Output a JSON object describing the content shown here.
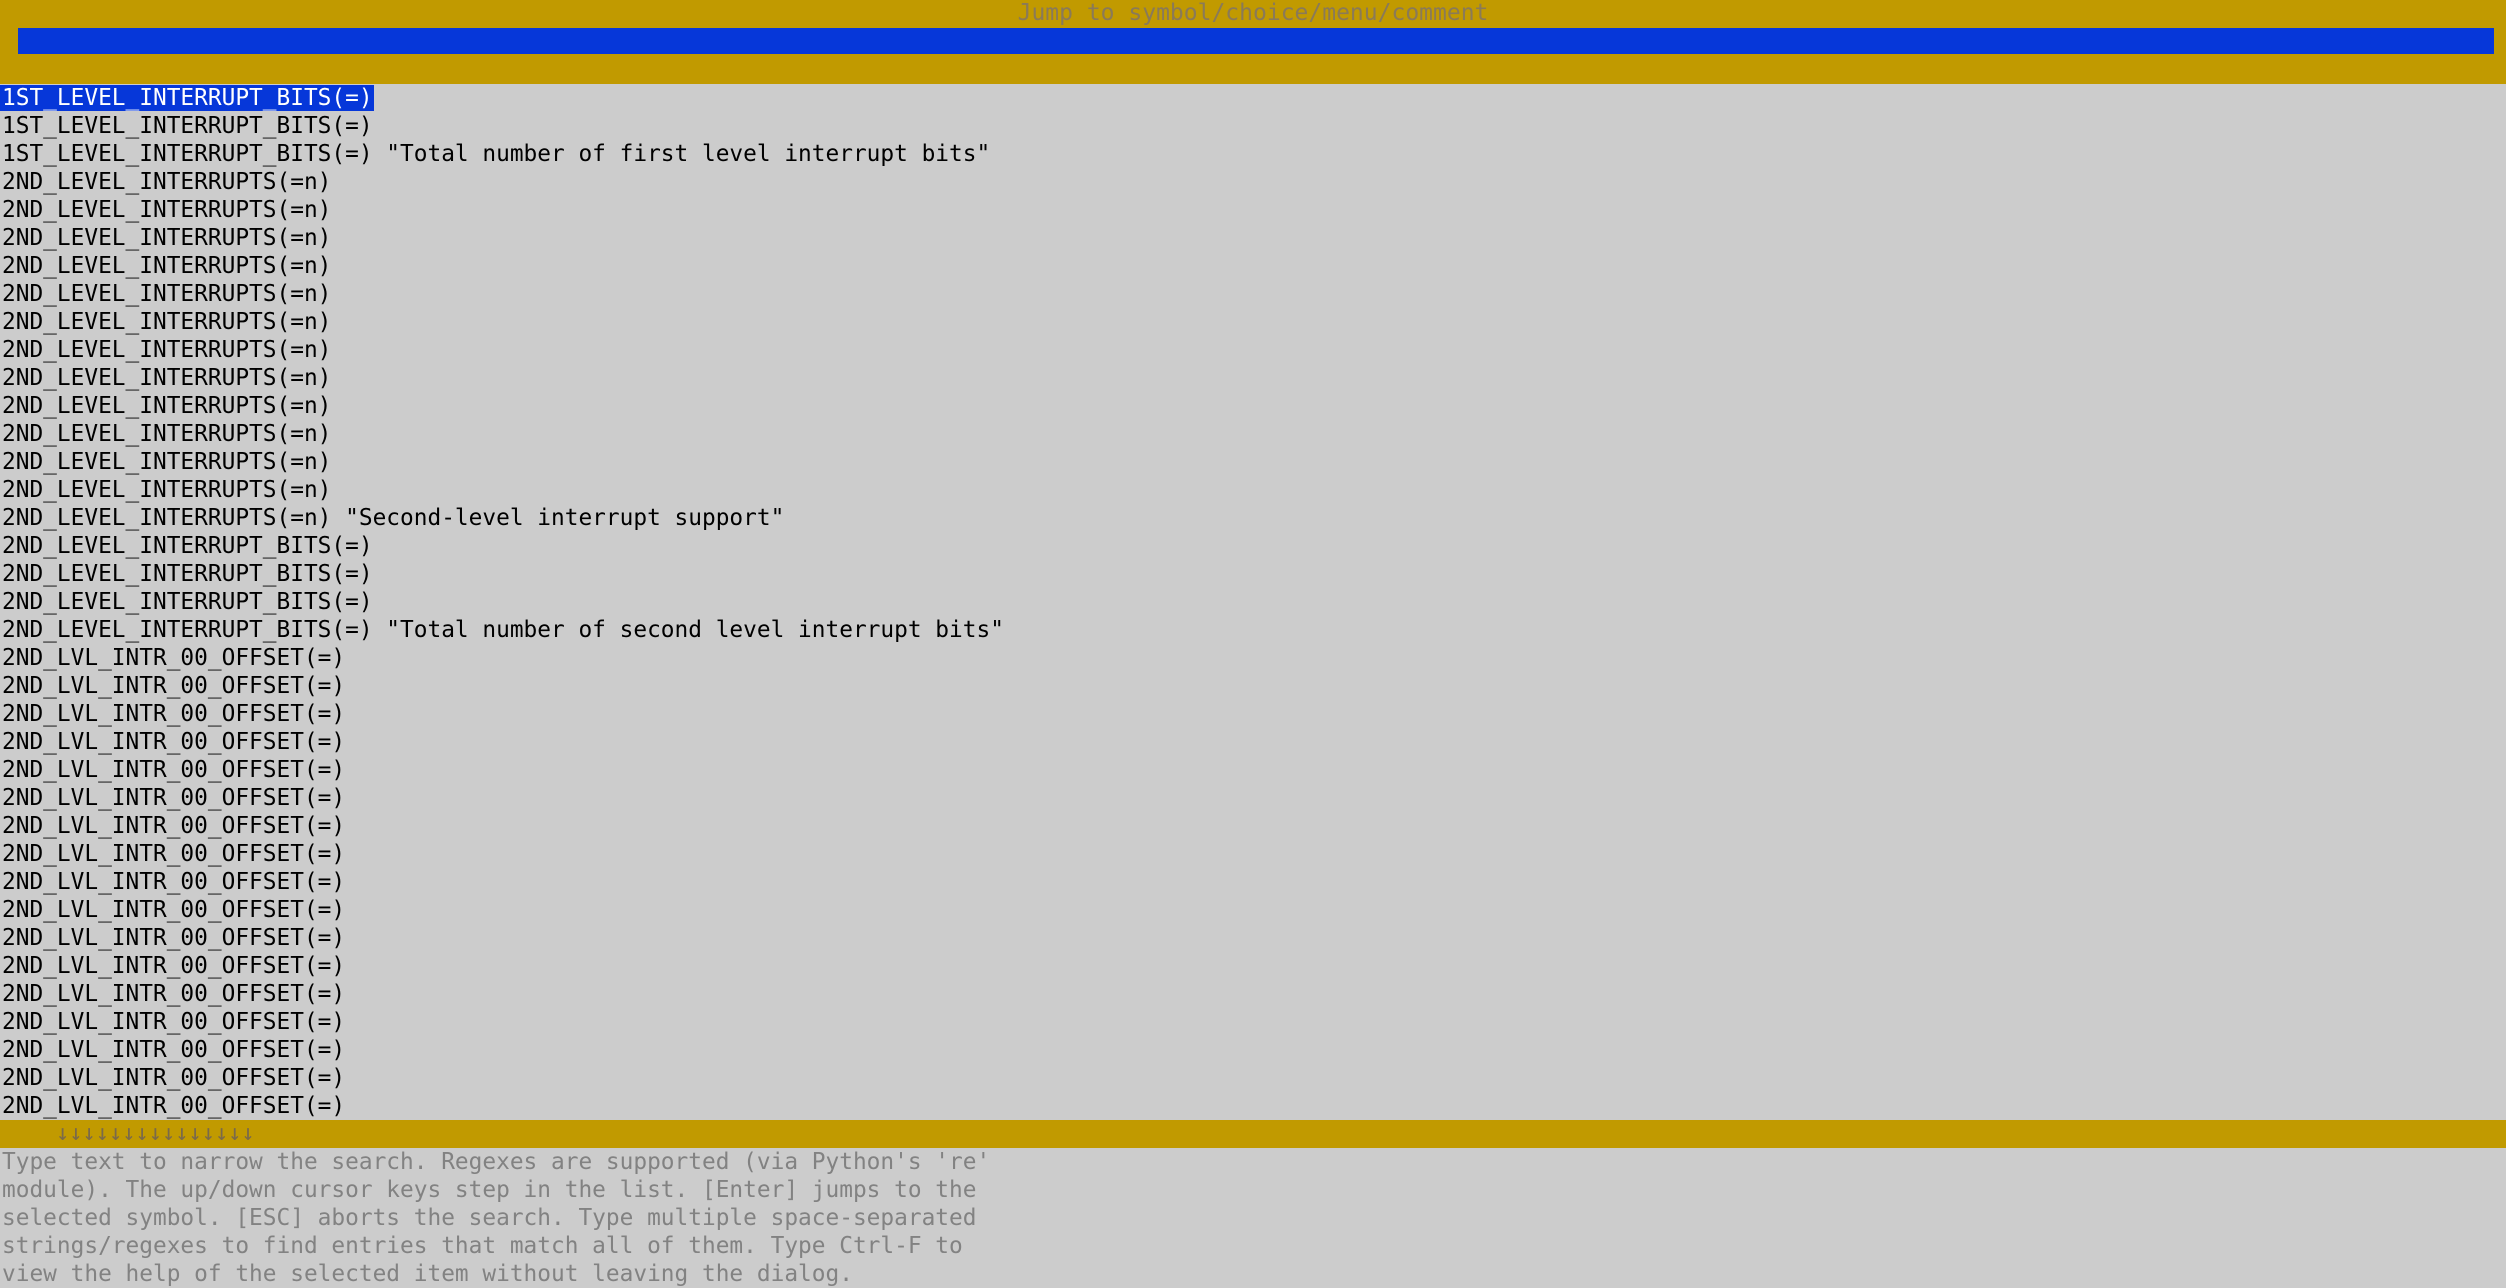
{
  "dialog": {
    "title": "Jump to symbol/choice/menu/comment",
    "search_value": ""
  },
  "results": [
    "1ST_LEVEL_INTERRUPT_BITS(=)",
    "1ST_LEVEL_INTERRUPT_BITS(=)",
    "1ST_LEVEL_INTERRUPT_BITS(=) \"Total number of first level interrupt bits\"",
    "2ND_LEVEL_INTERRUPTS(=n)",
    "2ND_LEVEL_INTERRUPTS(=n)",
    "2ND_LEVEL_INTERRUPTS(=n)",
    "2ND_LEVEL_INTERRUPTS(=n)",
    "2ND_LEVEL_INTERRUPTS(=n)",
    "2ND_LEVEL_INTERRUPTS(=n)",
    "2ND_LEVEL_INTERRUPTS(=n)",
    "2ND_LEVEL_INTERRUPTS(=n)",
    "2ND_LEVEL_INTERRUPTS(=n)",
    "2ND_LEVEL_INTERRUPTS(=n)",
    "2ND_LEVEL_INTERRUPTS(=n)",
    "2ND_LEVEL_INTERRUPTS(=n)",
    "2ND_LEVEL_INTERRUPTS(=n) \"Second-level interrupt support\"",
    "2ND_LEVEL_INTERRUPT_BITS(=)",
    "2ND_LEVEL_INTERRUPT_BITS(=)",
    "2ND_LEVEL_INTERRUPT_BITS(=)",
    "2ND_LEVEL_INTERRUPT_BITS(=) \"Total number of second level interrupt bits\"",
    "2ND_LVL_INTR_00_OFFSET(=)",
    "2ND_LVL_INTR_00_OFFSET(=)",
    "2ND_LVL_INTR_00_OFFSET(=)",
    "2ND_LVL_INTR_00_OFFSET(=)",
    "2ND_LVL_INTR_00_OFFSET(=)",
    "2ND_LVL_INTR_00_OFFSET(=)",
    "2ND_LVL_INTR_00_OFFSET(=)",
    "2ND_LVL_INTR_00_OFFSET(=)",
    "2ND_LVL_INTR_00_OFFSET(=)",
    "2ND_LVL_INTR_00_OFFSET(=)",
    "2ND_LVL_INTR_00_OFFSET(=)",
    "2ND_LVL_INTR_00_OFFSET(=)",
    "2ND_LVL_INTR_00_OFFSET(=)",
    "2ND_LVL_INTR_00_OFFSET(=)",
    "2ND_LVL_INTR_00_OFFSET(=)",
    "2ND_LVL_INTR_00_OFFSET(=)",
    "2ND_LVL_INTR_00_OFFSET(=)"
  ],
  "selected_index": 0,
  "scroll_indicator": "↓↓↓↓↓↓↓↓↓↓↓↓↓↓↓",
  "help_lines": [
    "Type text to narrow the search. Regexes are supported (via Python's 're'",
    "module). The up/down cursor keys step in the list. [Enter] jumps to the",
    "selected symbol. [ESC] aborts the search. Type multiple space-separated",
    "strings/regexes to find entries that match all of them. Type Ctrl-F to",
    "view the help of the selected item without leaving the dialog."
  ],
  "colors": {
    "frame": "#c19a00",
    "input_background": "#0637d9",
    "selection": "#0637d9",
    "list_background": "#cccccc",
    "help_text": "#828282"
  }
}
